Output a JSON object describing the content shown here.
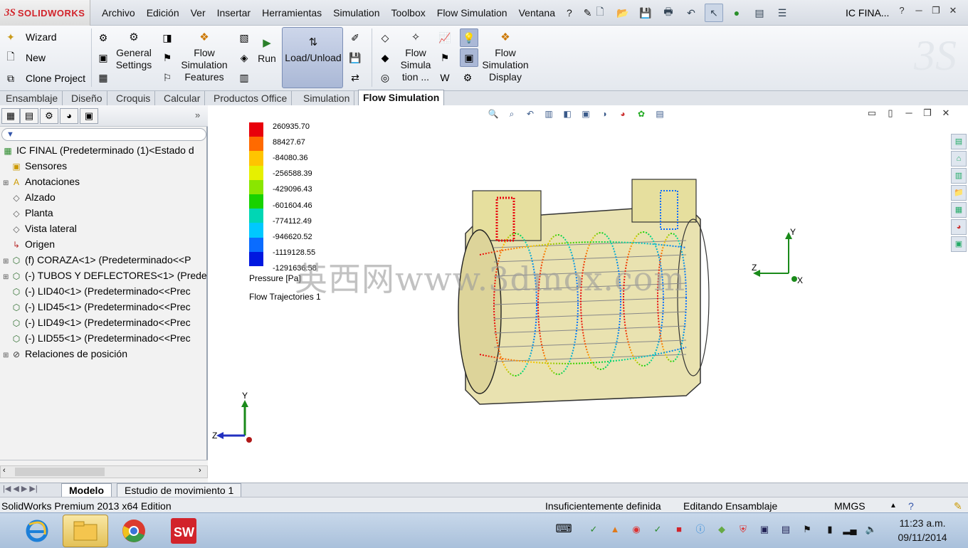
{
  "app": {
    "brand": "SOLIDWORKS",
    "document_title": "IC FINA..."
  },
  "menu": [
    "Archivo",
    "Edición",
    "Ver",
    "Insertar",
    "Herramientas",
    "Simulation",
    "Toolbox",
    "Flow Simulation",
    "Ventana",
    "?"
  ],
  "ribbon": {
    "wizard": "Wizard",
    "new": "New",
    "clone_project": "Clone Project",
    "general_settings": "General Settings",
    "flow_simulation_features": "Flow Simulation Features",
    "run": "Run",
    "load_unload": "Load/Unload",
    "flow_simulation_tools": "Flow Simula tion ...",
    "flow_simulation_display": "Flow Simulation Display"
  },
  "command_tabs": [
    "Ensamblaje",
    "Diseño",
    "Croquis",
    "Calcular",
    "Productos Office",
    "Simulation",
    "Flow Simulation"
  ],
  "active_tab": "Flow Simulation",
  "tree": [
    {
      "label": "IC FINAL  (Predeterminado (1)<Estado d",
      "level": 0,
      "exp": "",
      "icon": "asm"
    },
    {
      "label": "Sensores",
      "level": 1,
      "exp": "",
      "icon": "sensor"
    },
    {
      "label": "Anotaciones",
      "level": 1,
      "exp": "+",
      "icon": "annot"
    },
    {
      "label": "Alzado",
      "level": 1,
      "exp": "",
      "icon": "plane"
    },
    {
      "label": "Planta",
      "level": 1,
      "exp": "",
      "icon": "plane"
    },
    {
      "label": "Vista lateral",
      "level": 1,
      "exp": "",
      "icon": "plane"
    },
    {
      "label": "Origen",
      "level": 1,
      "exp": "",
      "icon": "origin"
    },
    {
      "label": "(f) CORAZA<1> (Predeterminado<<P",
      "level": 1,
      "exp": "+",
      "icon": "part"
    },
    {
      "label": "(-) TUBOS Y DEFLECTORES<1> (Prede",
      "level": 1,
      "exp": "+",
      "icon": "part"
    },
    {
      "label": "(-) LID40<1> (Predeterminado<<Prec",
      "level": 1,
      "exp": "",
      "icon": "part"
    },
    {
      "label": "(-) LID45<1> (Predeterminado<<Prec",
      "level": 1,
      "exp": "",
      "icon": "part"
    },
    {
      "label": "(-) LID49<1> (Predeterminado<<Prec",
      "level": 1,
      "exp": "",
      "icon": "part"
    },
    {
      "label": "(-) LID55<1> (Predeterminado<<Prec",
      "level": 1,
      "exp": "",
      "icon": "part"
    },
    {
      "label": "Relaciones de posición",
      "level": 1,
      "exp": "+",
      "icon": "mates"
    }
  ],
  "legend": {
    "labels": [
      "260935.70",
      "88427.67",
      "-84080.36",
      "-256588.39",
      "-429096.43",
      "-601604.46",
      "-774112.49",
      "-946620.52",
      "-1119128.55",
      "-1291636.58"
    ],
    "colors": [
      "#e8000b",
      "#ff6a00",
      "#ffc400",
      "#e6f000",
      "#8ae600",
      "#18d200",
      "#00d6b4",
      "#00c8ff",
      "#0a6cff",
      "#0018e0"
    ],
    "title": "Pressure [Pa]",
    "subtitle": "Flow Trajectories 1"
  },
  "watermark": "英西网www.3dmox.com",
  "axes": {
    "x": "X",
    "y": "Y",
    "z": "Z"
  },
  "bottom_tabs": [
    "Modelo",
    "Estudio de movimiento 1"
  ],
  "status": {
    "edition": "SolidWorks Premium 2013 x64 Edition",
    "definition": "Insuficientemente definida",
    "editing": "Editando Ensamblaje",
    "units": "MMGS"
  },
  "clock": {
    "time": "11:23 a.m.",
    "date": "09/11/2014"
  },
  "colors": {
    "ribbon_active": "#aab8d6",
    "brand": "#d2232a",
    "taskbar": "#a9c0db"
  }
}
